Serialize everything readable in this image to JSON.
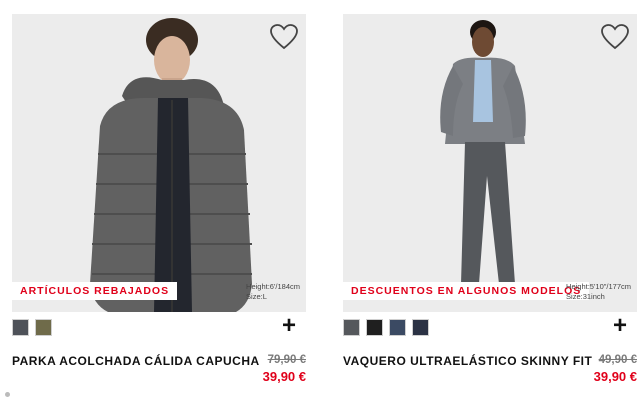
{
  "products": [
    {
      "badge": "ARTÍCULOS REBAJADOS",
      "model_height": "Height:6'/184cm",
      "model_size": "Size:L",
      "swatches": [
        "#4e5259",
        "#6f6b4a"
      ],
      "name": "PARKA ACOLCHADA CÁLIDA CAPUCHA",
      "old_price": "79,90 €",
      "new_price": "39,90 €"
    },
    {
      "badge": "DESCUENTOS EN ALGUNOS MODELOS",
      "model_height": "Height:5'10\"/177cm",
      "model_size": "Size:31inch",
      "swatches": [
        "#55585c",
        "#1f1f1f",
        "#3b4a63",
        "#2b3244"
      ],
      "name": "VAQUERO ULTRAELÁSTICO SKINNY FIT",
      "old_price": "49,90 €",
      "new_price": "39,90 €"
    }
  ],
  "icons": {
    "favorite": "heart-outline-icon",
    "add": "plus-icon"
  },
  "colors": {
    "sale_red": "#e0001a",
    "photo_bg": "#ececec"
  }
}
